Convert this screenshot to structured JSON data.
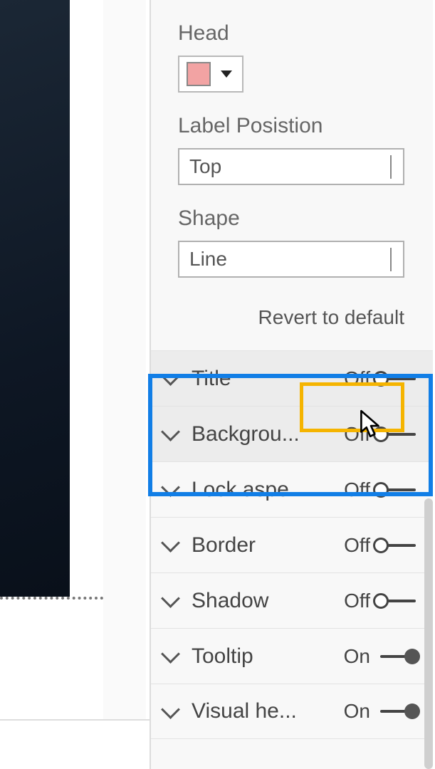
{
  "colors": {
    "head_swatch": "#f2a3a3"
  },
  "fields": {
    "head_label": "Head",
    "label_position_label": "Label Posistion",
    "label_position_value": "Top",
    "shape_label": "Shape",
    "shape_value": "Line"
  },
  "revert_link": "Revert to default",
  "toggle_states": {
    "on": "On",
    "off": "Off"
  },
  "rows": [
    {
      "label": "Title",
      "on": false
    },
    {
      "label": "Backgrou...",
      "on": false
    },
    {
      "label": "Lock aspe...",
      "on": false
    },
    {
      "label": "Border",
      "on": false
    },
    {
      "label": "Shadow",
      "on": false
    },
    {
      "label": "Tooltip",
      "on": true
    },
    {
      "label": "Visual he...",
      "on": true
    }
  ]
}
